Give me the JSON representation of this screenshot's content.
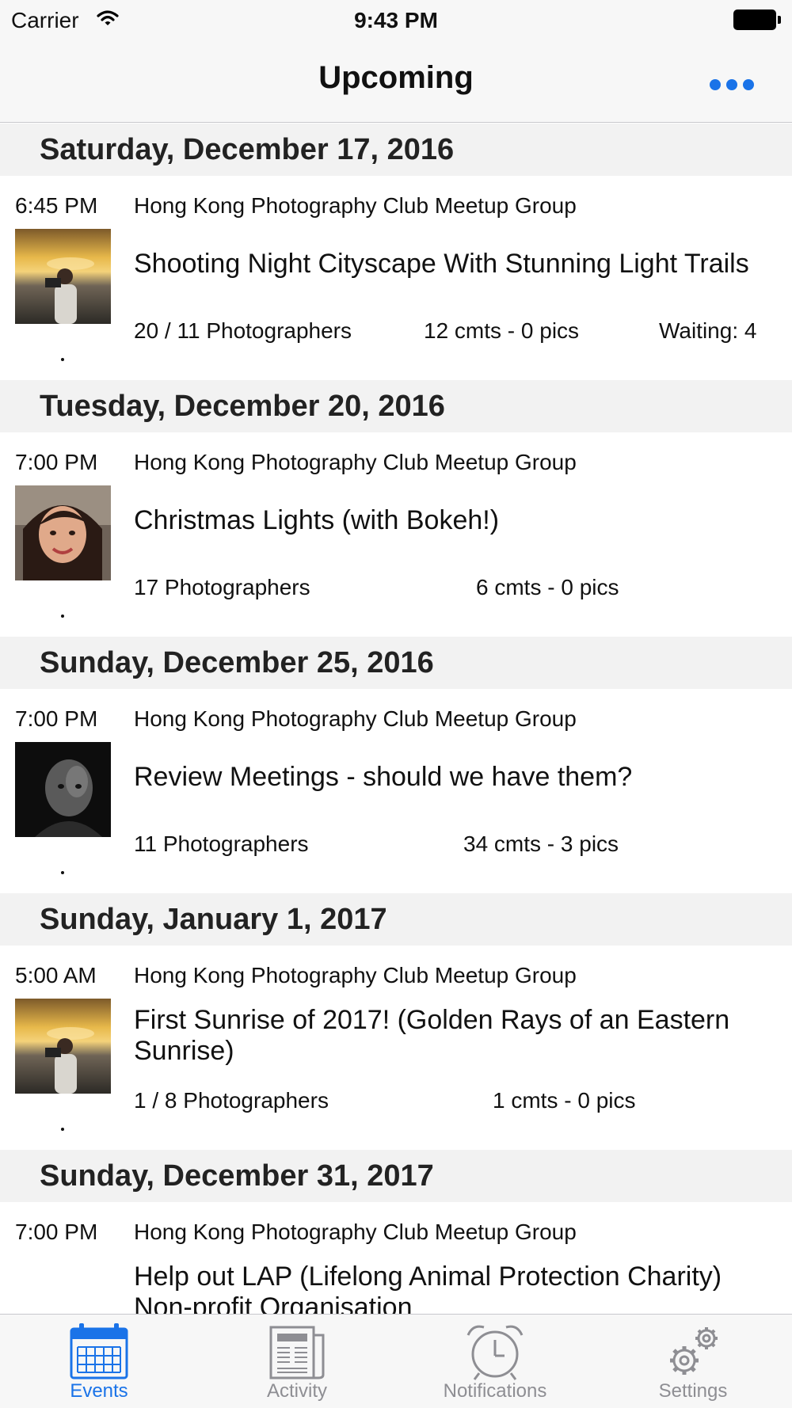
{
  "status_bar": {
    "carrier": "Carrier",
    "time": "9:43 PM"
  },
  "nav": {
    "title": "Upcoming",
    "more_icon": "ellipsis-icon"
  },
  "colors": {
    "accent": "#1a73e8",
    "header_bg": "#f2f2f2",
    "bar_bg": "#f7f7f7",
    "inactive": "#8e8e93"
  },
  "days": [
    {
      "date": "Saturday, December 17, 2016",
      "event": {
        "time": "6:45 PM",
        "group": "Hong Kong Photography Club Meetup Group",
        "title": "Shooting Night Cityscape With Stunning Light Trails",
        "photographers": "20 / 11 Photographers",
        "comments": "12 cmts - 0 pics",
        "waiting": "Waiting: 4"
      }
    },
    {
      "date": "Tuesday, December 20, 2016",
      "event": {
        "time": "7:00 PM",
        "group": "Hong Kong Photography Club Meetup Group",
        "title": "Christmas Lights (with Bokeh!)",
        "photographers": "17 Photographers",
        "comments": "6 cmts - 0 pics"
      }
    },
    {
      "date": "Sunday, December 25, 2016",
      "event": {
        "time": "7:00 PM",
        "group": "Hong Kong Photography Club Meetup Group",
        "title": "Review Meetings - should we have them?",
        "photographers": "11 Photographers",
        "comments": "34 cmts - 3 pics"
      }
    },
    {
      "date": "Sunday, January 1, 2017",
      "event": {
        "time": "5:00 AM",
        "group": "Hong Kong Photography Club Meetup Group",
        "title": "First Sunrise of 2017! (Golden Rays of an Eastern Sunrise)",
        "photographers": "1 / 8 Photographers",
        "comments": "1 cmts - 0 pics"
      }
    },
    {
      "date": "Sunday, December 31, 2017",
      "event": {
        "time": "7:00 PM",
        "group": "Hong Kong Photography Club Meetup Group",
        "title": "Help out LAP (Lifelong Animal Protection Charity) Non-profit Organisation"
      }
    }
  ],
  "tabs": [
    {
      "label": "Events",
      "icon": "calendar-icon",
      "active": true
    },
    {
      "label": "Activity",
      "icon": "newspaper-icon",
      "active": false
    },
    {
      "label": "Notifications",
      "icon": "alarm-clock-icon",
      "active": false
    },
    {
      "label": "Settings",
      "icon": "gears-icon",
      "active": false
    }
  ]
}
